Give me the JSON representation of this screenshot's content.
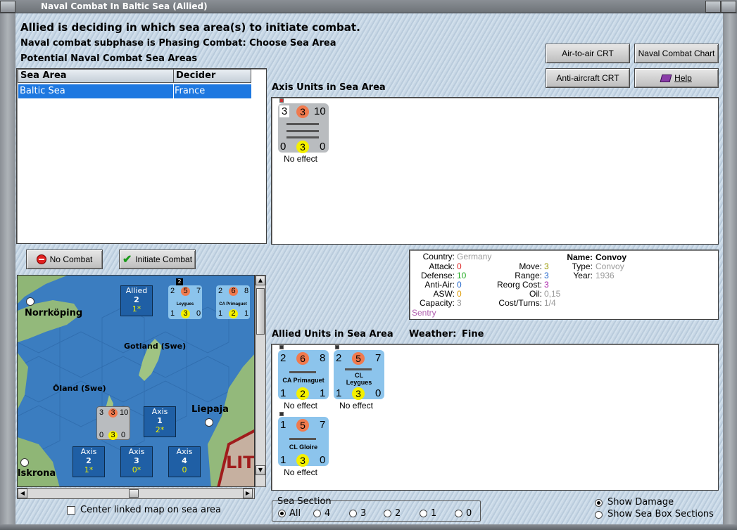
{
  "window": {
    "title": "Naval Combat In Baltic Sea (Allied)"
  },
  "header": {
    "line1": "Allied is deciding in which sea area(s) to initiate combat.",
    "line2": "Naval combat subphase is Phasing Combat: Choose Sea Area",
    "line3": "Potential Naval Combat Sea Areas"
  },
  "buttons": {
    "air_to_air": "Air-to-air CRT",
    "naval_chart": "Naval Combat Chart",
    "anti_aircraft": "Anti-aircraft CRT",
    "help": "Help",
    "no_combat": "No Combat",
    "initiate_combat": "Initiate Combat"
  },
  "sea_table": {
    "headers": [
      "Sea Area",
      "Decider"
    ],
    "rows": [
      {
        "sea_area": "Baltic Sea",
        "decider": "France"
      }
    ]
  },
  "axis_section": {
    "label": "Axis Units in Sea Area",
    "units": [
      {
        "top": [
          "3",
          "3",
          "10"
        ],
        "bottom": [
          "0",
          "3",
          "0"
        ],
        "name": "",
        "effect": "No effect"
      }
    ]
  },
  "unit_info": {
    "country_label": "Country:",
    "country": "Germany",
    "attack_label": "Attack:",
    "attack": "0",
    "defense_label": "Defense:",
    "defense": "10",
    "antiair_label": "Anti-Air:",
    "antiair": "0",
    "asw_label": "ASW:",
    "asw": "0",
    "capacity_label": "Capacity:",
    "capacity": "3",
    "sentry": "Sentry",
    "move_label": "Move:",
    "move": "3",
    "range_label": "Range:",
    "range": "3",
    "reorg_label": "Reorg Cost:",
    "reorg": "3",
    "oil_label": "Oil:",
    "oil": "0,15",
    "cost_label": "Cost/Turns:",
    "cost": "1/4",
    "name_label": "Name:",
    "name": "Convoy",
    "type_label": "Type:",
    "type": "Convoy",
    "year_label": "Year:",
    "year": "1936"
  },
  "allied_section": {
    "label": "Allied Units in Sea Area",
    "weather_label": "Weather:",
    "weather": "Fine",
    "units": [
      {
        "top": [
          "2",
          "6",
          "8"
        ],
        "bottom": [
          "1",
          "2",
          "1"
        ],
        "name": "CA Primaguet",
        "effect": "No effect"
      },
      {
        "top": [
          "2",
          "5",
          "7"
        ],
        "bottom": [
          "1",
          "3",
          "0"
        ],
        "name": "CL\nLeygues",
        "name1": "CL",
        "name2": "Leygues",
        "effect": "No effect"
      },
      {
        "top": [
          "1",
          "5",
          "7"
        ],
        "bottom": [
          "1",
          "3",
          "0"
        ],
        "name": "CL Gloire",
        "effect": "No effect"
      }
    ]
  },
  "map": {
    "labels": {
      "norrkoping": "Norrköping",
      "gotland": "Gotland (Swe)",
      "oland": "Öland (Swe)",
      "liepaja": "Liepaja",
      "karlskrona": "lskrona",
      "lit": "LIT"
    },
    "boxes": [
      {
        "side": "Allied",
        "num": "2",
        "sub": "1*"
      },
      {
        "side": "Axis",
        "num": "1",
        "sub": "2*"
      },
      {
        "side": "Axis",
        "num": "2",
        "sub": "1*"
      },
      {
        "side": "Axis",
        "num": "3",
        "sub": "0*"
      },
      {
        "side": "Axis",
        "num": "4",
        "sub": "0"
      }
    ],
    "mini_counters": [
      {
        "top": [
          "2",
          "5",
          "7"
        ],
        "bottom": [
          "1",
          "3",
          "0"
        ],
        "name": "Leygues"
      },
      {
        "top": [
          "2",
          "6",
          "8"
        ],
        "bottom": [
          "1",
          "2",
          "1"
        ],
        "name": "CA Primaguet"
      },
      {
        "top": [
          "3",
          "3",
          "10"
        ],
        "bottom": [
          "0",
          "3",
          "0"
        ],
        "name": ""
      }
    ],
    "stack_badge": "2"
  },
  "center_map_checkbox": "Center linked map on sea area",
  "sea_section": {
    "label": "Sea Section",
    "options": [
      "All",
      "4",
      "3",
      "2",
      "1",
      "0"
    ],
    "selected": "All"
  },
  "display_options": {
    "show_damage": "Show Damage",
    "show_sections": "Show Sea Box Sections"
  },
  "colors": {
    "selection": "#1e78e0",
    "counter_allied": "#8cc4ec",
    "counter_axis": "#b9bcbf",
    "attack_circle": "#f07a4e",
    "def_circle": "#f4f000"
  }
}
